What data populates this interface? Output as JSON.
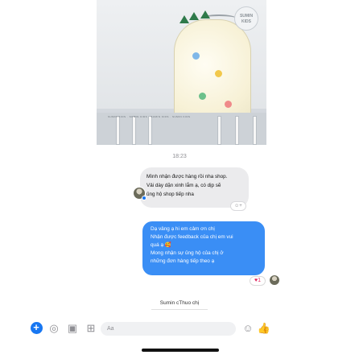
{
  "chat": {
    "image_tag": "SUMIN KIDS",
    "image_strip": "SUMIN KIDS · SUMIN KIDS · SUMIN KIDS · SUMIN KIDS",
    "timestamp": "18:23",
    "incoming_message": {
      "lines": [
        "Mình nhận được hàng rồi nha shop.",
        "Vải dày dặn xinh lắm ạ, có dịp sẽ",
        "ủng hộ shop tiếp nha"
      ]
    },
    "outgoing_message": {
      "lines": [
        "Dạ vâng ạ hi em cảm ơn chị",
        "Nhận được feedback của chị em vui",
        "quá ạ 🥰",
        "Mong nhận sự ủng hộ của chị ở",
        "những đơn hàng tiếp theo ạ"
      ],
      "reaction_count": "1"
    },
    "sender_label": "Sumin cThuo chị"
  },
  "composer": {
    "placeholder": "Aa"
  },
  "colors": {
    "accent": "#1877f2",
    "outgoing_bubble": "#3a8ef5",
    "incoming_bubble": "#ebebed"
  },
  "icons": {
    "plus": "plus-circle-icon",
    "camera": "camera-icon",
    "image": "image-icon",
    "mic": "microphone-icon",
    "emoji": "emoji-icon",
    "like": "thumbs-up-icon"
  }
}
